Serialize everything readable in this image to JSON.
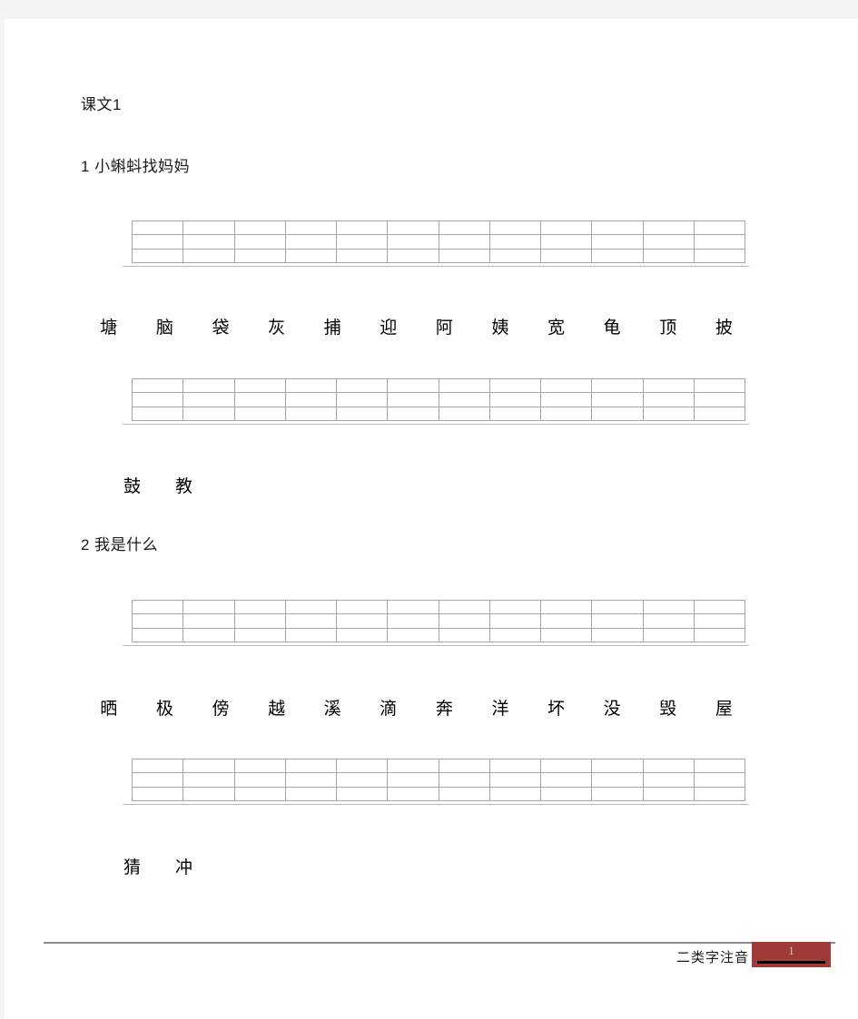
{
  "document": {
    "unit_heading": "课文1",
    "lessons": [
      {
        "heading": "1  小蝌蚪找妈妈",
        "char_rows": [
          {
            "cells": 12,
            "chars": [
              "塘",
              "脑",
              "袋",
              "灰",
              "捕",
              "迎",
              "阿",
              "姨",
              "宽",
              "龟",
              "顶",
              "披"
            ]
          },
          {
            "cells": 12,
            "chars": [
              "鼓",
              "教"
            ]
          }
        ]
      },
      {
        "heading": "2  我是什么",
        "char_rows": [
          {
            "cells": 12,
            "chars": [
              "晒",
              "极",
              "傍",
              "越",
              "溪",
              "滴",
              "奔",
              "洋",
              "坏",
              "没",
              "毁",
              "屋"
            ]
          },
          {
            "cells": 12,
            "chars": [
              "猜",
              "冲"
            ]
          }
        ]
      }
    ]
  },
  "footer": {
    "label": "二类字注音",
    "page_number": "1",
    "box_color": "#9e3b38",
    "number_color": "#d9c9a3"
  }
}
